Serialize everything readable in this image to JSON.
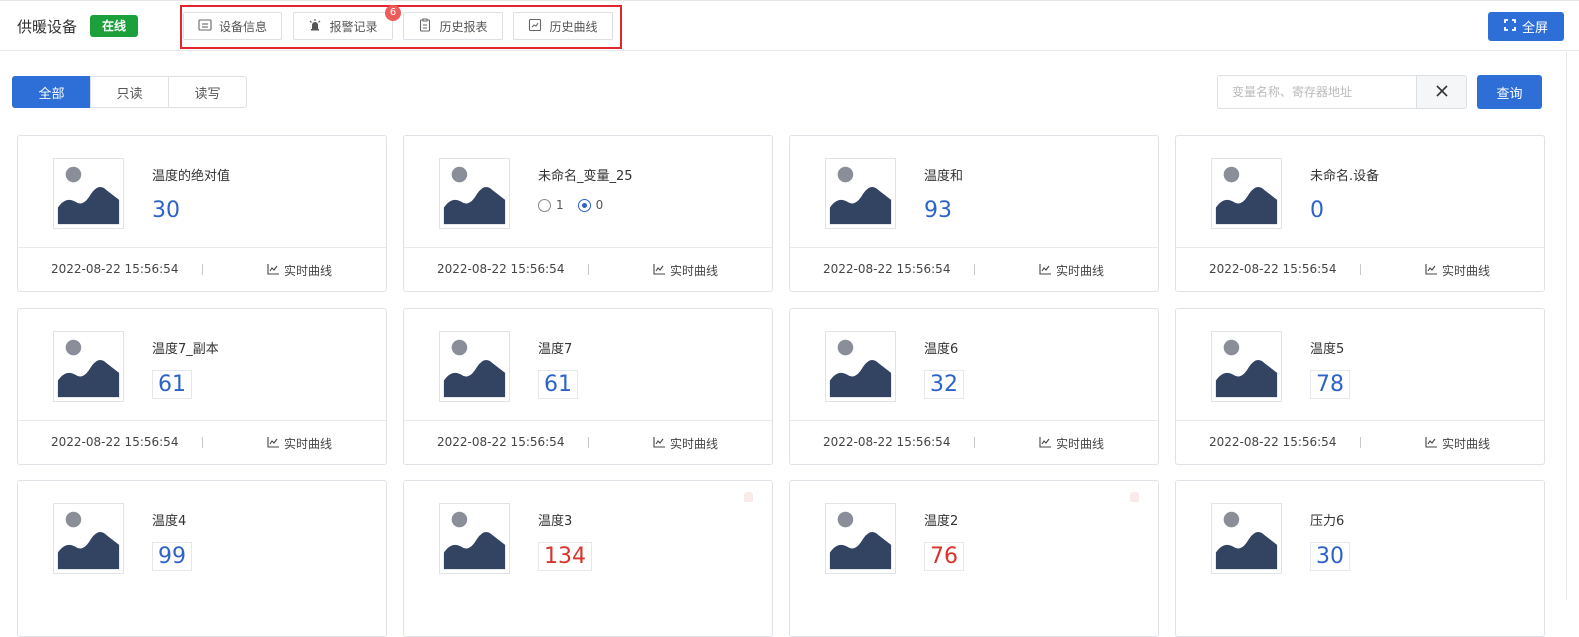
{
  "header": {
    "device_title": "供暖设备",
    "status": "在线",
    "tabs": [
      {
        "label": "设备信息",
        "icon": "device-info-icon"
      },
      {
        "label": "报警记录",
        "icon": "alarm-light-icon"
      },
      {
        "label": "历史报表",
        "icon": "clipboard-icon"
      },
      {
        "label": "历史曲线",
        "icon": "curve-icon"
      }
    ],
    "alarm_count": "6",
    "fullscreen_label": "全屏"
  },
  "filter": {
    "segments": [
      "全部",
      "只读",
      "读写"
    ],
    "active_segment": "全部",
    "search_placeholder": "变量名称、寄存器地址",
    "search_value": "",
    "query_label": "查询"
  },
  "cards": [
    {
      "name": "温度的绝对值",
      "value": "30",
      "time": "2022-08-22 15:56:54",
      "curve_label": "实时曲线"
    },
    {
      "name": "未命名_变量_25",
      "radio_options": [
        "1",
        "0"
      ],
      "radio_selected": "0",
      "time": "2022-08-22 15:56:54",
      "curve_label": "实时曲线"
    },
    {
      "name": "温度和",
      "value": "93",
      "time": "2022-08-22 15:56:54",
      "curve_label": "实时曲线"
    },
    {
      "name": "未命名.设备",
      "value": "0",
      "time": "2022-08-22 15:56:54",
      "curve_label": "实时曲线"
    },
    {
      "name": "温度7_副本",
      "value": "61",
      "time": "2022-08-22 15:56:54",
      "curve_label": "实时曲线"
    },
    {
      "name": "温度7",
      "value": "61",
      "time": "2022-08-22 15:56:54",
      "curve_label": "实时曲线"
    },
    {
      "name": "温度6",
      "value": "32",
      "time": "2022-08-22 15:56:54",
      "curve_label": "实时曲线"
    },
    {
      "name": "温度5",
      "value": "78",
      "time": "2022-08-22 15:56:54",
      "curve_label": "实时曲线"
    },
    {
      "name": "温度4",
      "value": "99",
      "time": "",
      "curve_label": ""
    },
    {
      "name": "温度3",
      "value": "134",
      "alarm": true,
      "time": "",
      "curve_label": ""
    },
    {
      "name": "温度2",
      "value": "76",
      "alarm": true,
      "time": "",
      "curve_label": ""
    },
    {
      "name": "压力6",
      "value": "30",
      "time": "",
      "curve_label": ""
    }
  ],
  "colors": {
    "primary": "#2d6fd6",
    "online": "#1ca03c",
    "value": "#2d63c9",
    "alarm_value": "#d9342b",
    "highlight": "#e3262b"
  }
}
